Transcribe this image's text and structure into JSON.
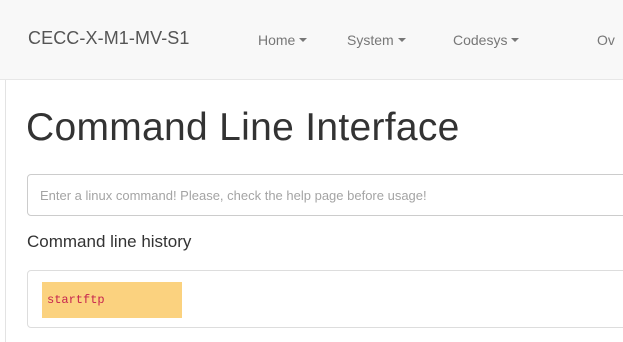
{
  "navbar": {
    "brand": "CECC-X-M1-MV-S1",
    "items": [
      {
        "label": "Home"
      },
      {
        "label": "System"
      },
      {
        "label": "Codesys"
      },
      {
        "label": "Ov"
      }
    ]
  },
  "main": {
    "title": "Command Line Interface",
    "command_input": {
      "value": "",
      "placeholder": "Enter a linux command! Please, check the help page before usage!"
    },
    "history_label": "Command line history",
    "history": [
      {
        "command": "startftp"
      }
    ]
  },
  "colors": {
    "navbar_bg": "#f8f8f8",
    "history_highlight": "#fbd27f",
    "history_text": "#c7254e"
  }
}
